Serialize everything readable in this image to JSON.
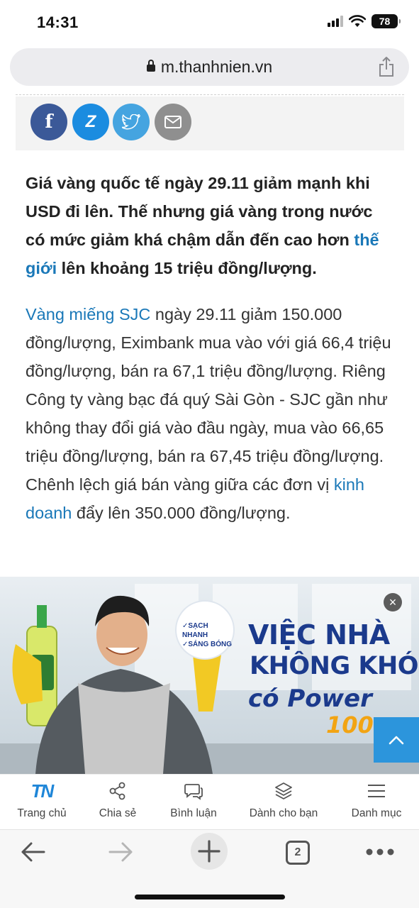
{
  "status": {
    "time": "14:31",
    "battery": "78"
  },
  "browser": {
    "url": "m.thanhnien.vn",
    "tab_count": "2"
  },
  "article": {
    "lead_text": "Giá vàng quốc tế ngày 29.11 giảm mạnh khi USD đi lên. Thế nhưng giá vàng trong nước có mức giảm khá chậm dẫn đến cao hơn ",
    "lead_link": "thế giới",
    "lead_tail": " lên khoảng 15 triệu đồng/lượng.",
    "body_link1": "Vàng miếng SJC",
    "body_text1": " ngày 29.11 giảm 150.000 đồng/lượng, Eximbank mua vào với giá 66,4 triệu đồng/lượng, bán ra 67,1 triệu đồng/lượng. Riêng Công ty vàng bạc đá quý Sài Gòn - SJC gần như không thay đổi giá vào đầu ngày, mua vào 66,65 triệu đồng/lượng, bán ra 67,45 triệu đồng/lượng. Chênh lệch giá bán vàng giữa các đơn vị ",
    "body_link2": "kinh doanh",
    "body_text2": " đẩy lên 350.000 đồng/lượng."
  },
  "social": {
    "facebook": "f",
    "zalo": "Z"
  },
  "ad": {
    "badge_line1": "✓SẠCH NHANH",
    "badge_line2": "✓SÁNG BÓNG",
    "title_line1": "VIỆC NHÀ",
    "title_line2": "KHÔNG KHÓ",
    "title_prefix": "có",
    "brand": "Power",
    "brand_number": "100",
    "close": "×"
  },
  "site_nav": [
    {
      "label": "Trang chủ",
      "icon": "tn-logo"
    },
    {
      "label": "Chia sẻ",
      "icon": "share-nodes-icon"
    },
    {
      "label": "Bình luận",
      "icon": "comment-icon"
    },
    {
      "label": "Dành cho bạn",
      "icon": "layers-icon"
    },
    {
      "label": "Danh mục",
      "icon": "menu-icon"
    }
  ],
  "site_logo": "TN",
  "colors": {
    "link": "#1a78b8",
    "accent": "#2c95dc",
    "facebook": "#3b5998",
    "zalo": "#1b8ce0",
    "twitter": "#45a4e0"
  }
}
